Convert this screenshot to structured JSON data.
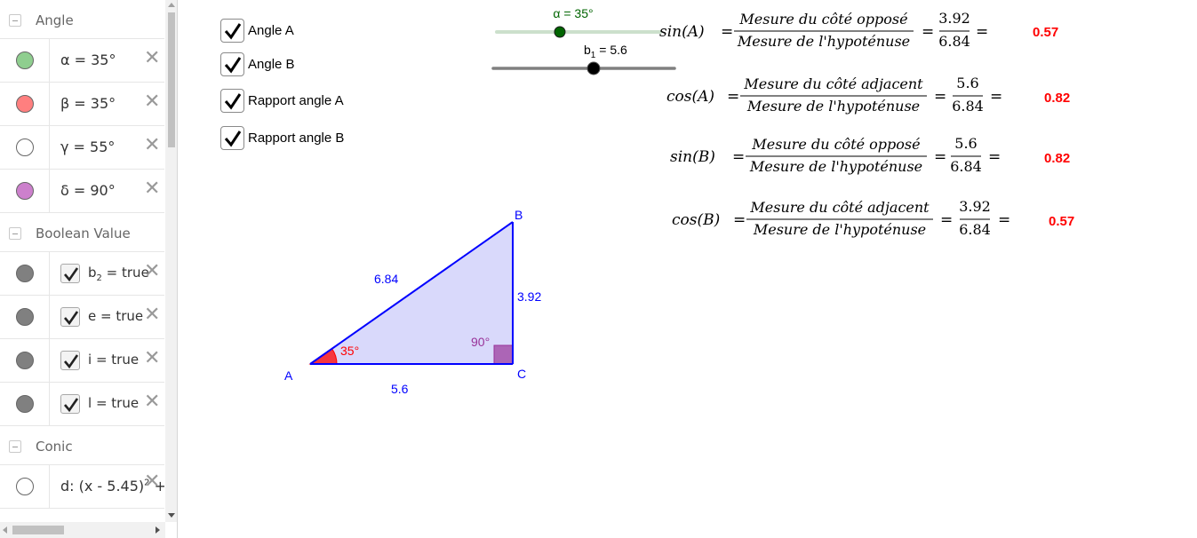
{
  "colors": {
    "segment": "#0000ff",
    "triangle_fill": "#d9d9fb",
    "angle_alpha": "#ff0000",
    "angle_right": "#993399",
    "slider_alpha_track": "#cce0cc",
    "slider_alpha_point": "#006400",
    "result": "#ff0000"
  },
  "algebra": {
    "groups": [
      {
        "title": "Angle"
      },
      {
        "title": "Boolean Value"
      },
      {
        "title": "Conic"
      }
    ],
    "angles": [
      {
        "label": "α = 35°",
        "marble_color": "#8fce8f"
      },
      {
        "label": "β = 35°",
        "marble_color": "#ff7f7f"
      },
      {
        "label": "γ = 55°",
        "marble_color": "#ffffff"
      },
      {
        "label": "δ = 90°",
        "marble_color": "#cc80cc"
      }
    ],
    "booleans": [
      {
        "var": "b",
        "sub": "2",
        "rest": " = true"
      },
      {
        "var": "e",
        "sub": "",
        "rest": " = true"
      },
      {
        "var": "i",
        "sub": "",
        "rest": " = true"
      },
      {
        "var": "l",
        "sub": "",
        "rest": " = true"
      }
    ],
    "conic": {
      "head": "d: (x - 5.45)",
      "sup": "2",
      "tail": " +"
    },
    "close_glyph": "✕"
  },
  "checkboxes": [
    {
      "label": "Angle A",
      "checked": true
    },
    {
      "label": "Angle B",
      "checked": true
    },
    {
      "label": "Rapport angle A",
      "checked": true
    },
    {
      "label": "Rapport angle B",
      "checked": true
    }
  ],
  "sliders": {
    "alpha": {
      "label": "α = 35°"
    },
    "b1": {
      "var": "b",
      "sub": "1",
      "rest": " = 5.6"
    }
  },
  "triangle": {
    "points": {
      "A": "A",
      "B": "B",
      "C": "C"
    },
    "sides": {
      "hyp": "6.84",
      "opp": "3.92",
      "adj": "5.6"
    },
    "angle_A": "35°",
    "angle_C": "90°"
  },
  "formulas": [
    {
      "lhs": "sin(A)",
      "num_text": "Mesure du côté opposé",
      "den_text": "Mesure de l'hypoténuse",
      "num_val": "3.92",
      "den_val": "6.84",
      "result": "0.57"
    },
    {
      "lhs": "cos(A)",
      "num_text": "Mesure du côté adjacent",
      "den_text": "Mesure de l'hypoténuse",
      "num_val": "5.6",
      "den_val": "6.84",
      "result": "0.82"
    },
    {
      "lhs": "sin(B)",
      "num_text": "Mesure du côté opposé",
      "den_text": "Mesure de l'hypoténuse",
      "num_val": "5.6",
      "den_val": "6.84",
      "result": "0.82"
    },
    {
      "lhs": "cos(B)",
      "num_text": "Mesure du côté adjacent",
      "den_text": "Mesure de l'hypoténuse",
      "num_val": "3.92",
      "den_val": "6.84",
      "result": "0.57"
    }
  ]
}
